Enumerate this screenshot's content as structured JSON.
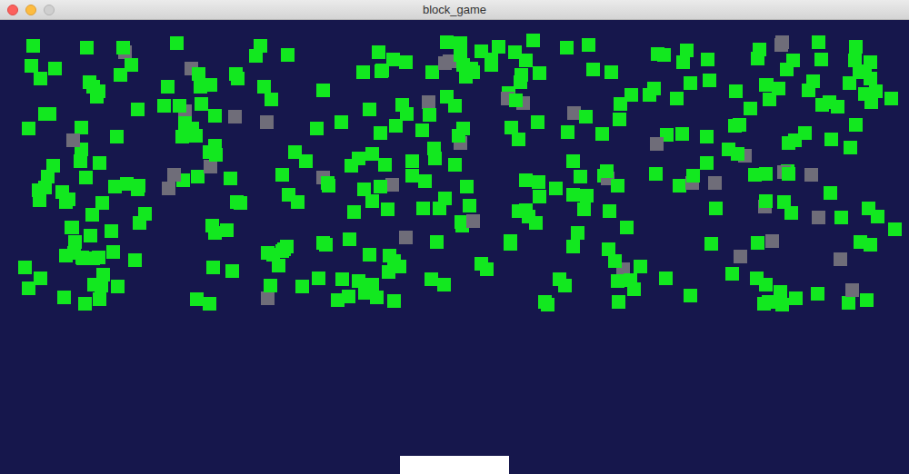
{
  "window": {
    "title": "block_game"
  },
  "blocks": [
    {
      "color": "#12e81f"
    },
    {
      "color": "#12e81f"
    },
    {
      "color": "#12e81f"
    },
    {
      "color": "#12e81f"
    },
    {
      "color": "#6f6d79"
    },
    {
      "color": "#12e81f"
    },
    {
      "color": "#12e81f"
    },
    {
      "color": "#12e81f"
    },
    {
      "color": "#12e81f"
    },
    {
      "color": "#12e81f"
    },
    {
      "color": "#12e81f"
    },
    {
      "color": "#12e81f"
    },
    {
      "color": "#12e81f"
    },
    {
      "color": "#12e81f"
    },
    {
      "color": "#6f6d79"
    },
    {
      "color": "#12e81f"
    },
    {
      "color": "#12e81f"
    },
    {
      "color": "#12e81f"
    },
    {
      "color": "#12e81f"
    },
    {
      "color": "#12e81f"
    },
    {
      "color": "#12e81f"
    },
    {
      "color": "#12e81f"
    },
    {
      "color": "#12e81f"
    },
    {
      "color": "#12e81f"
    },
    {
      "color": "#6f6d79"
    },
    {
      "color": "#12e81f"
    },
    {
      "color": "#12e81f"
    },
    {
      "color": "#12e81f"
    },
    {
      "color": "#12e81f"
    },
    {
      "color": "#12e81f"
    },
    {
      "color": "#12e81f"
    },
    {
      "color": "#12e81f"
    },
    {
      "color": "#12e81f"
    },
    {
      "color": "#12e81f"
    },
    {
      "color": "#6f6d79"
    },
    {
      "color": "#12e81f"
    },
    {
      "color": "#12e81f"
    },
    {
      "color": "#12e81f"
    },
    {
      "color": "#12e81f"
    },
    {
      "color": "#12e81f"
    },
    {
      "color": "#12e81f"
    },
    {
      "color": "#12e81f"
    },
    {
      "color": "#12e81f"
    },
    {
      "color": "#12e81f"
    },
    {
      "color": "#6f6d79"
    },
    {
      "color": "#12e81f"
    },
    {
      "color": "#12e81f"
    },
    {
      "color": "#12e81f"
    },
    {
      "color": "#12e81f"
    },
    {
      "color": "#12e81f"
    },
    {
      "color": "#12e81f"
    },
    {
      "color": "#12e81f"
    },
    {
      "color": "#12e81f"
    },
    {
      "color": "#12e81f"
    },
    {
      "color": "#6f6d79"
    },
    {
      "color": "#12e81f"
    },
    {
      "color": "#12e81f"
    },
    {
      "color": "#12e81f"
    },
    {
      "color": "#12e81f"
    },
    {
      "color": "#12e81f"
    },
    {
      "color": "#12e81f"
    },
    {
      "color": "#12e81f"
    },
    {
      "color": "#12e81f"
    },
    {
      "color": "#12e81f"
    },
    {
      "color": "#6f6d79"
    },
    {
      "color": "#12e81f"
    },
    {
      "color": "#12e81f"
    },
    {
      "color": "#12e81f"
    },
    {
      "color": "#12e81f"
    },
    {
      "color": "#12e81f"
    },
    {
      "color": "#12e81f"
    },
    {
      "color": "#12e81f"
    },
    {
      "color": "#12e81f"
    },
    {
      "color": "#12e81f"
    },
    {
      "color": "#6f6d79"
    },
    {
      "color": "#12e81f"
    },
    {
      "color": "#12e81f"
    },
    {
      "color": "#12e81f"
    },
    {
      "color": "#12e81f"
    },
    {
      "color": "#12e81f"
    },
    {
      "color": "#12e81f"
    },
    {
      "color": "#12e81f"
    },
    {
      "color": "#12e81f"
    },
    {
      "color": "#12e81f"
    },
    {
      "color": "#6f6d79"
    },
    {
      "color": "#12e81f"
    },
    {
      "color": "#12e81f"
    },
    {
      "color": "#12e81f"
    },
    {
      "color": "#12e81f"
    },
    {
      "color": "#12e81f"
    },
    {
      "color": "#12e81f"
    },
    {
      "color": "#12e81f"
    },
    {
      "color": "#12e81f"
    },
    {
      "color": "#12e81f"
    },
    {
      "color": "#6f6d79"
    },
    {
      "color": "#12e81f"
    },
    {
      "color": "#12e81f"
    },
    {
      "color": "#12e81f"
    },
    {
      "color": "#12e81f"
    },
    {
      "color": "#12e81f"
    },
    {
      "color": "#12e81f"
    },
    {
      "color": "#12e81f"
    },
    {
      "color": "#12e81f"
    },
    {
      "color": "#12e81f"
    },
    {
      "color": "#6f6d79"
    },
    {
      "color": "#12e81f"
    },
    {
      "color": "#12e81f"
    },
    {
      "color": "#12e81f"
    },
    {
      "color": "#12e81f"
    },
    {
      "color": "#12e81f"
    },
    {
      "color": "#12e81f"
    },
    {
      "color": "#12e81f"
    },
    {
      "color": "#12e81f"
    },
    {
      "color": "#12e81f"
    },
    {
      "color": "#6f6d79"
    },
    {
      "color": "#12e81f"
    },
    {
      "color": "#12e81f"
    },
    {
      "color": "#12e81f"
    },
    {
      "color": "#12e81f"
    },
    {
      "color": "#12e81f"
    },
    {
      "color": "#12e81f"
    },
    {
      "color": "#12e81f"
    },
    {
      "color": "#12e81f"
    },
    {
      "color": "#12e81f"
    },
    {
      "color": "#6f6d79"
    },
    {
      "color": "#12e81f"
    },
    {
      "color": "#12e81f"
    },
    {
      "color": "#12e81f"
    },
    {
      "color": "#12e81f"
    },
    {
      "color": "#12e81f"
    },
    {
      "color": "#12e81f"
    },
    {
      "color": "#12e81f"
    },
    {
      "color": "#12e81f"
    },
    {
      "color": "#12e81f"
    },
    {
      "color": "#6f6d79"
    },
    {
      "color": "#12e81f"
    },
    {
      "color": "#12e81f"
    },
    {
      "color": "#12e81f"
    },
    {
      "color": "#12e81f"
    },
    {
      "color": "#12e81f"
    },
    {
      "color": "#12e81f"
    },
    {
      "color": "#12e81f"
    },
    {
      "color": "#12e81f"
    },
    {
      "color": "#12e81f"
    },
    {
      "color": "#6f6d79"
    },
    {
      "color": "#12e81f"
    },
    {
      "color": "#12e81f"
    },
    {
      "color": "#12e81f"
    },
    {
      "color": "#12e81f"
    },
    {
      "color": "#12e81f"
    },
    {
      "color": "#12e81f"
    },
    {
      "color": "#12e81f"
    },
    {
      "color": "#12e81f"
    },
    {
      "color": "#12e81f"
    },
    {
      "color": "#6f6d79"
    },
    {
      "color": "#12e81f"
    },
    {
      "color": "#12e81f"
    },
    {
      "color": "#12e81f"
    },
    {
      "color": "#12e81f"
    },
    {
      "color": "#12e81f"
    },
    {
      "color": "#12e81f"
    },
    {
      "color": "#12e81f"
    },
    {
      "color": "#12e81f"
    },
    {
      "color": "#12e81f"
    },
    {
      "color": "#6f6d79"
    },
    {
      "color": "#12e81f"
    },
    {
      "color": "#12e81f"
    },
    {
      "color": "#12e81f"
    },
    {
      "color": "#12e81f"
    },
    {
      "color": "#12e81f"
    },
    {
      "color": "#12e81f"
    },
    {
      "color": "#12e81f"
    },
    {
      "color": "#12e81f"
    },
    {
      "color": "#12e81f"
    },
    {
      "color": "#6f6d79"
    },
    {
      "color": "#12e81f"
    },
    {
      "color": "#12e81f"
    },
    {
      "color": "#12e81f"
    },
    {
      "color": "#12e81f"
    },
    {
      "color": "#12e81f"
    },
    {
      "color": "#12e81f"
    },
    {
      "color": "#12e81f"
    },
    {
      "color": "#12e81f"
    },
    {
      "color": "#12e81f"
    },
    {
      "color": "#6f6d79"
    },
    {
      "color": "#12e81f"
    },
    {
      "color": "#12e81f"
    },
    {
      "color": "#12e81f"
    },
    {
      "color": "#12e81f"
    },
    {
      "color": "#12e81f"
    },
    {
      "color": "#12e81f"
    },
    {
      "color": "#12e81f"
    },
    {
      "color": "#12e81f"
    },
    {
      "color": "#12e81f"
    },
    {
      "color": "#6f6d79"
    },
    {
      "color": "#12e81f"
    },
    {
      "color": "#12e81f"
    },
    {
      "color": "#12e81f"
    },
    {
      "color": "#12e81f"
    },
    {
      "color": "#12e81f"
    },
    {
      "color": "#12e81f"
    },
    {
      "color": "#12e81f"
    },
    {
      "color": "#12e81f"
    },
    {
      "color": "#12e81f"
    },
    {
      "color": "#6f6d79"
    },
    {
      "color": "#12e81f"
    },
    {
      "color": "#12e81f"
    },
    {
      "color": "#12e81f"
    },
    {
      "color": "#12e81f"
    },
    {
      "color": "#12e81f"
    },
    {
      "color": "#12e81f"
    },
    {
      "color": "#12e81f"
    },
    {
      "color": "#12e81f"
    },
    {
      "color": "#12e81f"
    },
    {
      "color": "#6f6d79"
    },
    {
      "color": "#12e81f"
    },
    {
      "color": "#12e81f"
    },
    {
      "color": "#12e81f"
    },
    {
      "color": "#12e81f"
    },
    {
      "color": "#12e81f"
    },
    {
      "color": "#12e81f"
    },
    {
      "color": "#12e81f"
    },
    {
      "color": "#12e81f"
    },
    {
      "color": "#12e81f"
    },
    {
      "color": "#6f6d79"
    },
    {
      "color": "#12e81f"
    },
    {
      "color": "#12e81f"
    },
    {
      "color": "#12e81f"
    },
    {
      "color": "#12e81f"
    },
    {
      "color": "#12e81f"
    },
    {
      "color": "#12e81f"
    },
    {
      "color": "#12e81f"
    },
    {
      "color": "#12e81f"
    },
    {
      "color": "#12e81f"
    },
    {
      "color": "#6f6d79"
    },
    {
      "color": "#12e81f"
    },
    {
      "color": "#12e81f"
    },
    {
      "color": "#12e81f"
    },
    {
      "color": "#12e81f"
    },
    {
      "color": "#12e81f"
    },
    {
      "color": "#12e81f"
    },
    {
      "color": "#12e81f"
    },
    {
      "color": "#12e81f"
    },
    {
      "color": "#12e81f"
    },
    {
      "color": "#6f6d79"
    },
    {
      "color": "#12e81f"
    },
    {
      "color": "#12e81f"
    },
    {
      "color": "#12e81f"
    },
    {
      "color": "#12e81f"
    },
    {
      "color": "#12e81f"
    },
    {
      "color": "#12e81f"
    },
    {
      "color": "#12e81f"
    },
    {
      "color": "#12e81f"
    },
    {
      "color": "#12e81f"
    },
    {
      "color": "#6f6d79"
    },
    {
      "color": "#12e81f"
    },
    {
      "color": "#12e81f"
    },
    {
      "color": "#12e81f"
    },
    {
      "color": "#12e81f"
    },
    {
      "color": "#12e81f"
    },
    {
      "color": "#12e81f"
    },
    {
      "color": "#12e81f"
    },
    {
      "color": "#12e81f"
    },
    {
      "color": "#12e81f"
    },
    {
      "color": "#6f6d79"
    },
    {
      "color": "#12e81f"
    },
    {
      "color": "#12e81f"
    },
    {
      "color": "#12e81f"
    },
    {
      "color": "#12e81f"
    },
    {
      "color": "#12e81f"
    },
    {
      "color": "#12e81f"
    },
    {
      "color": "#12e81f"
    },
    {
      "color": "#12e81f"
    },
    {
      "color": "#12e81f"
    },
    {
      "color": "#6f6d79"
    },
    {
      "color": "#12e81f"
    },
    {
      "color": "#12e81f"
    },
    {
      "color": "#12e81f"
    },
    {
      "color": "#12e81f"
    },
    {
      "color": "#12e81f"
    },
    {
      "color": "#12e81f"
    },
    {
      "color": "#12e81f"
    },
    {
      "color": "#12e81f"
    },
    {
      "color": "#12e81f"
    },
    {
      "color": "#6f6d79"
    },
    {
      "color": "#12e81f"
    },
    {
      "color": "#12e81f"
    },
    {
      "color": "#12e81f"
    },
    {
      "color": "#12e81f"
    },
    {
      "color": "#12e81f"
    },
    {
      "color": "#12e81f"
    },
    {
      "color": "#12e81f"
    },
    {
      "color": "#12e81f"
    },
    {
      "color": "#12e81f"
    },
    {
      "color": "#6f6d79"
    },
    {
      "color": "#12e81f"
    },
    {
      "color": "#12e81f"
    },
    {
      "color": "#12e81f"
    },
    {
      "color": "#12e81f"
    },
    {
      "color": "#12e81f"
    },
    {
      "color": "#12e81f"
    },
    {
      "color": "#12e81f"
    },
    {
      "color": "#12e81f"
    },
    {
      "color": "#12e81f"
    },
    {
      "color": "#6f6d79"
    },
    {
      "color": "#12e81f"
    },
    {
      "color": "#12e81f"
    },
    {
      "color": "#12e81f"
    },
    {
      "color": "#12e81f"
    },
    {
      "color": "#12e81f"
    },
    {
      "color": "#12e81f"
    },
    {
      "color": "#12e81f"
    },
    {
      "color": "#12e81f"
    },
    {
      "color": "#12e81f"
    },
    {
      "color": "#6f6d79"
    },
    {
      "color": "#12e81f"
    },
    {
      "color": "#12e81f"
    },
    {
      "color": "#12e81f"
    },
    {
      "color": "#12e81f"
    },
    {
      "color": "#12e81f"
    },
    {
      "color": "#12e81f"
    },
    {
      "color": "#12e81f"
    },
    {
      "color": "#12e81f"
    },
    {
      "color": "#12e81f"
    },
    {
      "color": "#6f6d79"
    },
    {
      "color": "#12e81f"
    },
    {
      "color": "#12e81f"
    },
    {
      "color": "#12e81f"
    },
    {
      "color": "#12e81f"
    },
    {
      "color": "#12e81f"
    },
    {
      "color": "#12e81f"
    },
    {
      "color": "#12e81f"
    },
    {
      "color": "#12e81f"
    },
    {
      "color": "#12e81f"
    },
    {
      "color": "#6f6d79"
    },
    {
      "color": "#12e81f"
    },
    {
      "color": "#12e81f"
    },
    {
      "color": "#12e81f"
    },
    {
      "color": "#12e81f"
    },
    {
      "color": "#12e81f"
    },
    {
      "color": "#12e81f"
    },
    {
      "color": "#12e81f"
    },
    {
      "color": "#12e81f"
    },
    {
      "color": "#12e81f"
    },
    {
      "color": "#6f6d79"
    },
    {
      "color": "#12e81f"
    },
    {
      "color": "#12e81f"
    },
    {
      "color": "#12e81f"
    },
    {
      "color": "#12e81f"
    },
    {
      "color": "#12e81f"
    },
    {
      "color": "#12e81f"
    },
    {
      "color": "#12e81f"
    },
    {
      "color": "#12e81f"
    },
    {
      "color": "#12e81f"
    },
    {
      "color": "#6f6d79"
    },
    {
      "color": "#12e81f"
    },
    {
      "color": "#12e81f"
    },
    {
      "color": "#12e81f"
    },
    {
      "color": "#12e81f"
    },
    {
      "color": "#12e81f"
    },
    {
      "color": "#12e81f"
    },
    {
      "color": "#12e81f"
    },
    {
      "color": "#12e81f"
    },
    {
      "color": "#12e81f"
    },
    {
      "color": "#6f6d79"
    }
  ]
}
